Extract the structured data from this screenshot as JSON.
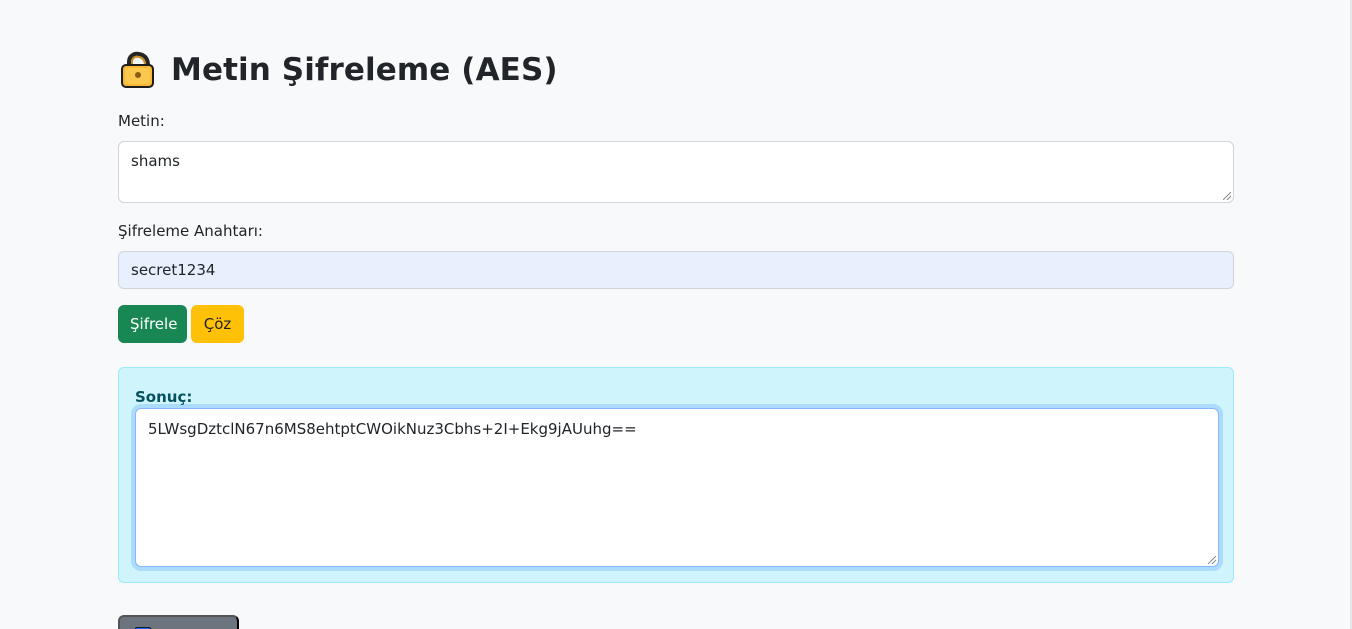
{
  "header": {
    "title": "Metin Şifreleme (AES)",
    "icon": "lock-icon",
    "accent_color": "#f6b735"
  },
  "form": {
    "text_label": "Metin:",
    "text_value": "shams",
    "key_label": "Şifreleme Anahtarı:",
    "key_value": "secret1234",
    "encrypt_button": "Şifrele",
    "decrypt_button": "Çöz"
  },
  "result": {
    "label": "Sonuç:",
    "value": "5LWsgDztclN67n6MS8ehtptCWOikNuz3Cbhs+2I+Ekg9jAUuhg=="
  },
  "footer": {
    "button_icon": "square-icon",
    "button_color": "#6c757d"
  }
}
